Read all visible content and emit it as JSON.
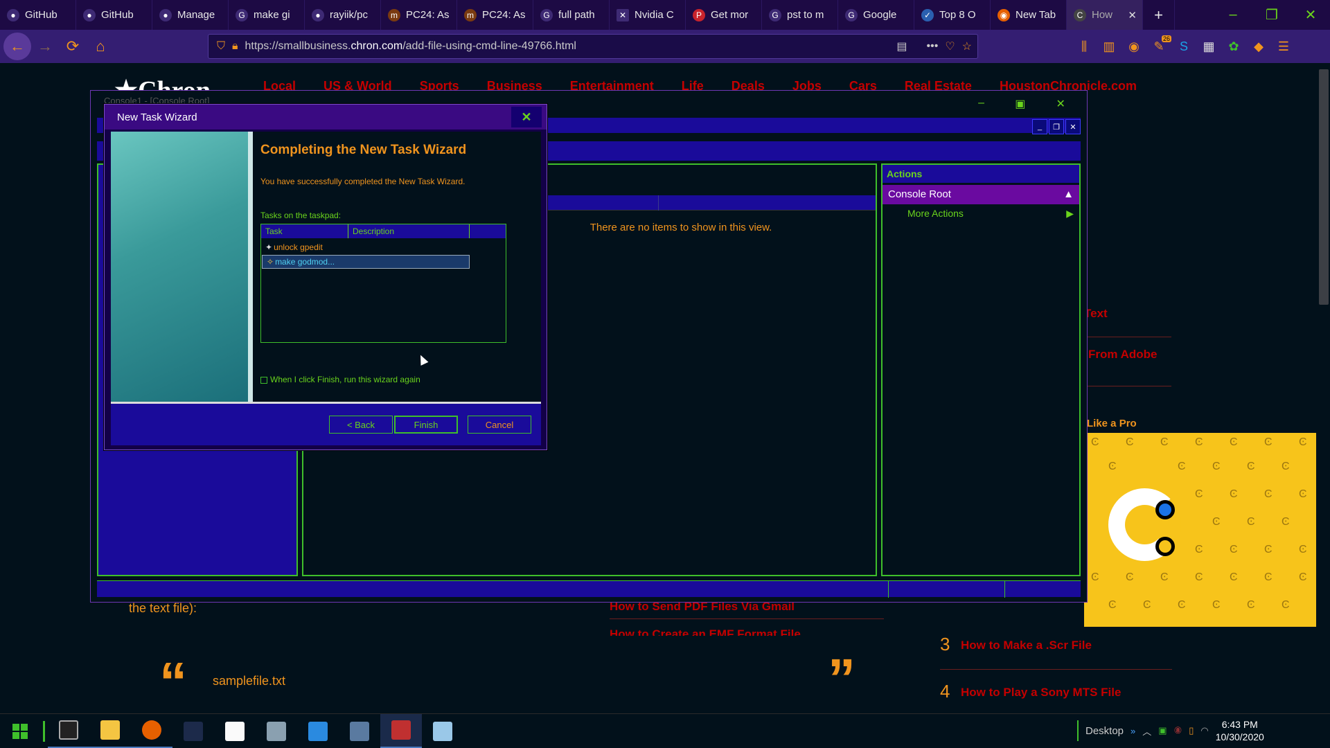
{
  "browser": {
    "tabs": [
      {
        "label": "GitHub",
        "icon": "github-icon"
      },
      {
        "label": "GitHub",
        "icon": "github-icon"
      },
      {
        "label": "Manage",
        "icon": "github-icon"
      },
      {
        "label": "make gi",
        "icon": "google-icon"
      },
      {
        "label": "rayiik/pc",
        "icon": "github-icon"
      },
      {
        "label": "PC24: As",
        "icon": "pc24-icon"
      },
      {
        "label": "PC24: As",
        "icon": "pc24-icon"
      },
      {
        "label": "full path",
        "icon": "google-icon"
      },
      {
        "label": "Nvidia C",
        "icon": "nvidia-icon"
      },
      {
        "label": "Get mor",
        "icon": "pinterest-icon"
      },
      {
        "label": "pst to m",
        "icon": "google-icon"
      },
      {
        "label": "Google",
        "icon": "google-icon"
      },
      {
        "label": "Top 8 O",
        "icon": "check-icon"
      },
      {
        "label": "New Tab",
        "icon": "firefox-icon"
      },
      {
        "label": "How",
        "icon": "chron-icon",
        "active": true
      }
    ],
    "url_prefix": "https://smallbusiness.",
    "url_host": "chron.com",
    "url_path": "/add-file-using-cmd-line-49766.html",
    "badge_count": "26"
  },
  "site": {
    "nav": [
      "Local",
      "US & World",
      "Sports",
      "Business",
      "Entertainment",
      "Life",
      "Deals",
      "Jobs",
      "Cars",
      "Real Estate",
      "HoustonChronicle.com"
    ],
    "article_fragment": "the text file):",
    "quote_text": "samplefile.txt",
    "center_links": [
      "How to Send PDF Files Via Gmail",
      "How to Create an EMF Format File"
    ],
    "sidebar_items": [
      {
        "num": "",
        "text": "Text"
      },
      {
        "num": "",
        "text": "From Adobe"
      },
      {
        "num": "",
        "text": "Like a Pro"
      },
      {
        "num": "3",
        "text": "How to Make a .Scr File"
      },
      {
        "num": "4",
        "text": "How to Play a Sony MTS File"
      }
    ]
  },
  "console": {
    "title": "Console1 - [Console Root]",
    "no_items": "There are no items to show in this view.",
    "actions_header": "Actions",
    "console_root": "Console Root",
    "more_actions": "More Actions"
  },
  "wizard": {
    "title": "New Task Wizard",
    "heading": "Completing the New Task Wizard",
    "message": "You have successfully completed the New Task Wizard.",
    "tasks_label": "Tasks on the taskpad:",
    "columns": [
      "Task",
      "Description"
    ],
    "tasks": [
      "unlock gpedit",
      "make godmod..."
    ],
    "checkbox_label": "When I click Finish, run this wizard again",
    "back": "< Back",
    "finish": "Finish",
    "cancel": "Cancel"
  },
  "taskbar": {
    "desktop_label": "Desktop",
    "time": "6:43 PM",
    "date": "10/30/2020"
  },
  "colors": {
    "accent_orange": "#f0941e",
    "accent_green": "#6ad41c",
    "link_red": "#c40000"
  }
}
